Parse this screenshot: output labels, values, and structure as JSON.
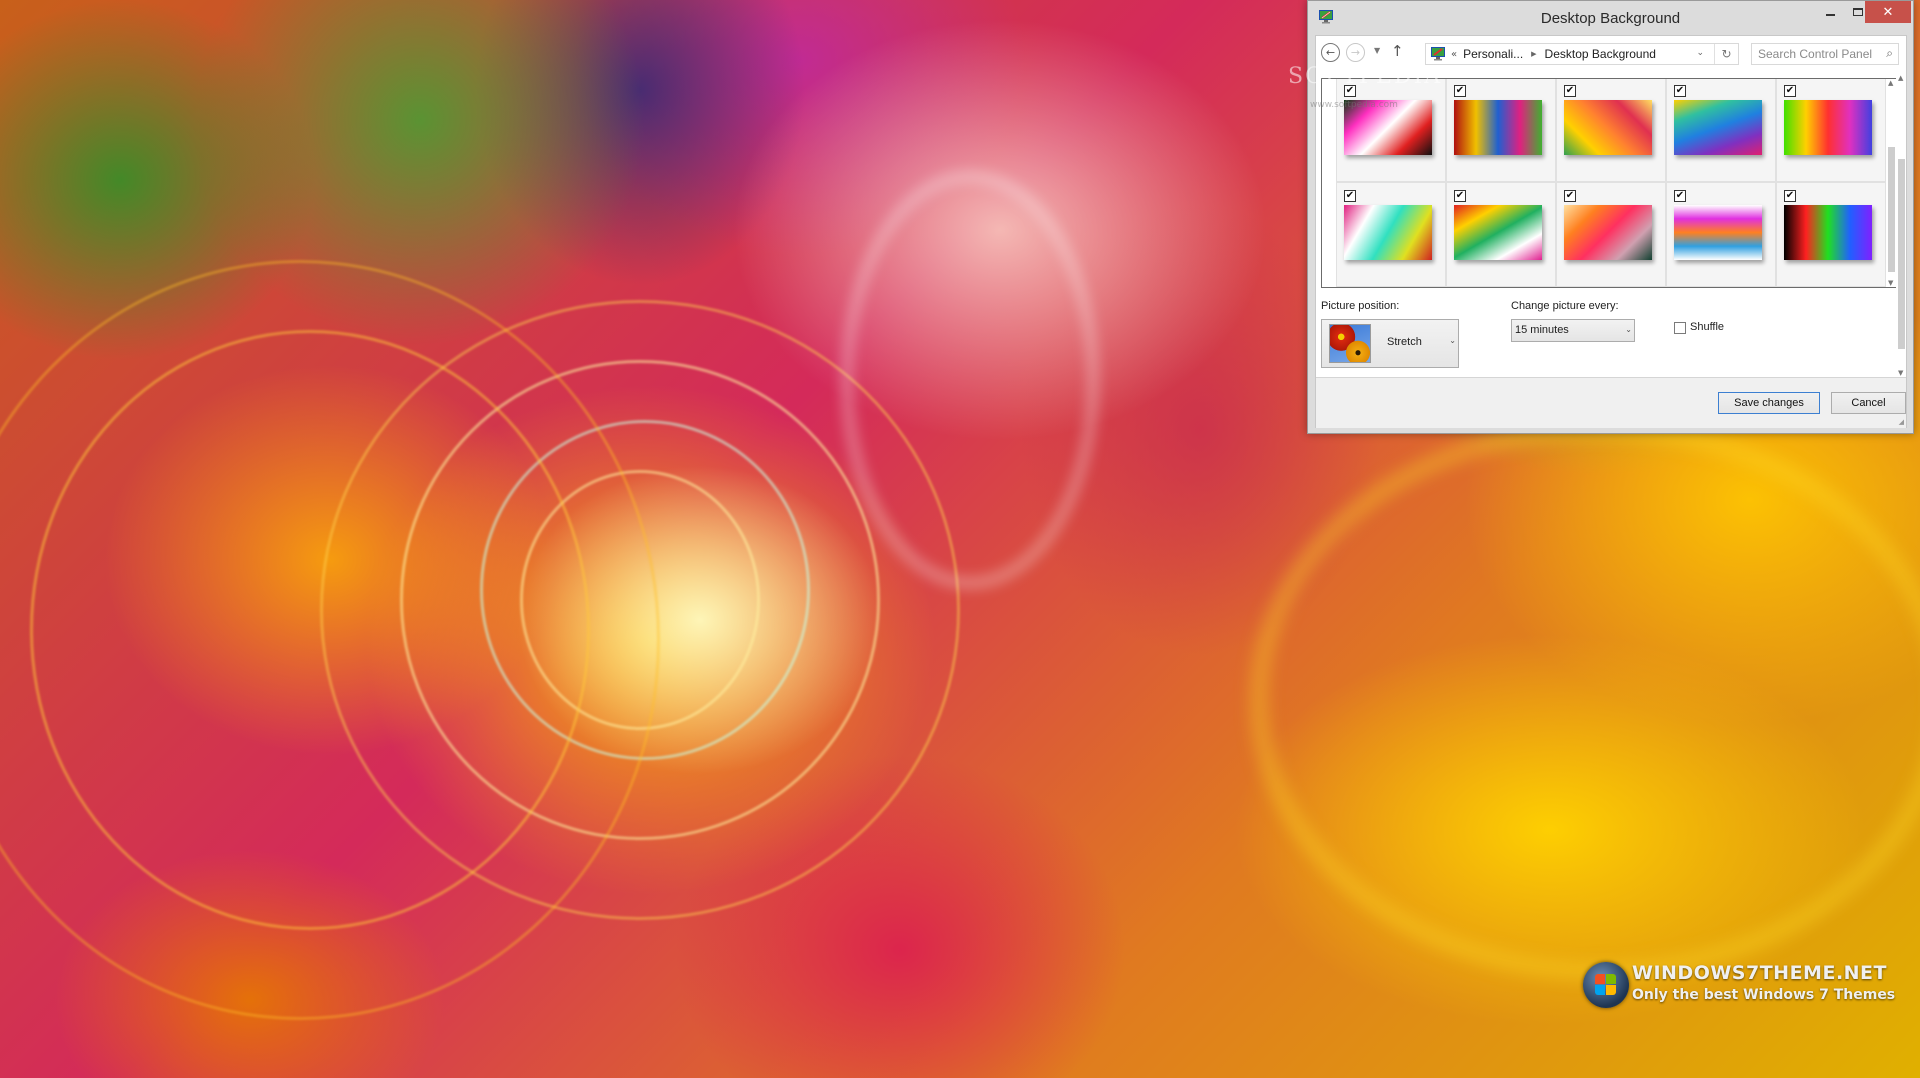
{
  "window": {
    "title": "Desktop Background",
    "controls": {
      "minimize": "minimize",
      "maximize": "maximize",
      "close": "✕"
    }
  },
  "nav": {
    "back_glyph": "←",
    "forward_glyph": "→",
    "recent_glyph": "▼",
    "up_glyph": "↑",
    "breadcrumb": {
      "overflow": "«",
      "segments": [
        "Personali...",
        "Desktop Background"
      ],
      "separator": "▶"
    },
    "dropdown_glyph": "⌄",
    "refresh_glyph": "↻",
    "search_placeholder": "Search Control Panel",
    "search_glyph": "⌕"
  },
  "thumbnails": [
    {
      "name": "neon-light-waves",
      "checked": true,
      "colors": [
        "#0a3a10",
        "#ff30c0",
        "#ffffff",
        "#e02020",
        "#101010"
      ]
    },
    {
      "name": "striped-wood-planks",
      "checked": true,
      "colors": [
        "#b01010",
        "#f0c000",
        "#2060d0",
        "#e02080",
        "#40b030"
      ]
    },
    {
      "name": "light-swirl",
      "checked": true,
      "colors": [
        "#30a050",
        "#ffd000",
        "#ff8030",
        "#e03050",
        "#ffe060"
      ]
    },
    {
      "name": "rainbow-waves",
      "checked": true,
      "colors": [
        "#ffd000",
        "#30c0a0",
        "#2080e0",
        "#8030c0",
        "#e02070"
      ]
    },
    {
      "name": "spectrum-streaks",
      "checked": true,
      "colors": [
        "#40e000",
        "#ffd000",
        "#ff3030",
        "#e030c0",
        "#4040e0"
      ]
    },
    {
      "name": "starburst",
      "checked": true,
      "colors": [
        "#e02080",
        "#ffffff",
        "#30e0c0",
        "#e0e020",
        "#d02020"
      ]
    },
    {
      "name": "rainbow-ribbon",
      "checked": true,
      "colors": [
        "#e02020",
        "#ffd000",
        "#20b060",
        "#ffffff",
        "#e02090"
      ]
    },
    {
      "name": "pixel-grid-gradient",
      "checked": true,
      "colors": [
        "#ffe0a0",
        "#ff8020",
        "#ff3060",
        "#d0a0b0",
        "#104030"
      ]
    },
    {
      "name": "color-splash",
      "checked": true,
      "colors": [
        "#ffffff",
        "#e030e0",
        "#ff8020",
        "#30a0e0",
        "#ffffff"
      ]
    },
    {
      "name": "dark-spectrum",
      "checked": true,
      "colors": [
        "#000000",
        "#ff2020",
        "#20e020",
        "#2060ff",
        "#8020ff"
      ]
    }
  ],
  "picture_position": {
    "label": "Picture position:",
    "value": "Stretch",
    "chevron": "⌄"
  },
  "change_picture": {
    "label": "Change picture every:",
    "value": "15 minutes",
    "chevron": "⌄"
  },
  "shuffle": {
    "label": "Shuffle",
    "checked": false
  },
  "buttons": {
    "save": "Save changes",
    "cancel": "Cancel"
  },
  "watermarks": {
    "softpedia": "SOFTPEDIA",
    "softpedia_url": "www.softpedia.com",
    "site_title": "WINDOWS7THEME.NET",
    "site_tagline": "Only the best Windows 7 Themes"
  },
  "colors": {
    "close_button": "#c7514a",
    "focused_button_border": "#3c7fd1",
    "window_frame": "#dcdcdc"
  }
}
